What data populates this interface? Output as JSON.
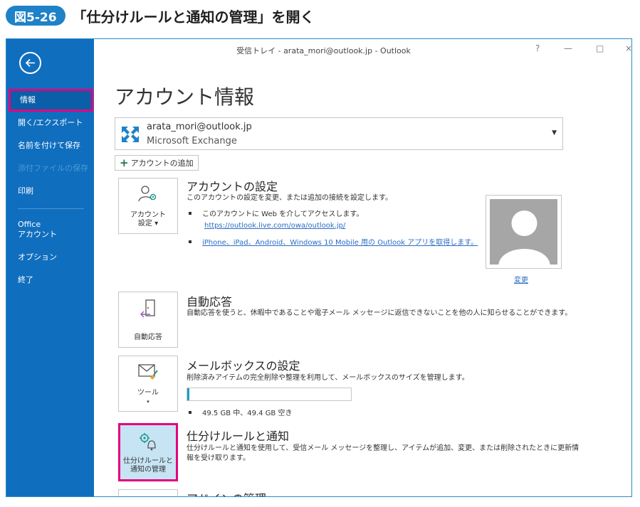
{
  "figure": {
    "badge": "図5-26",
    "title": "「仕分けルールと通知の管理」を開く"
  },
  "window": {
    "title": "受信トレイ - arata_mori@outlook.jp  -  Outlook",
    "help_label": "?",
    "minimize_label": "—",
    "restore_label": "□",
    "close_label": "×"
  },
  "sidebar": {
    "items": [
      {
        "label": "情報",
        "selected": true
      },
      {
        "label": "開く/エクスポート"
      },
      {
        "label": "名前を付けて保存"
      },
      {
        "label": "添付ファイルの保存",
        "disabled": true
      },
      {
        "label": "印刷"
      },
      {
        "label": "Office"
      },
      {
        "label": "アカウント"
      },
      {
        "label": "オプション"
      },
      {
        "label": "終了"
      }
    ]
  },
  "main": {
    "title": "アカウント情報",
    "account": {
      "email": "arata_mori@outlook.jp",
      "type": "Microsoft Exchange"
    },
    "add_account": "アカウントの追加",
    "account_settings": {
      "tile_line1": "アカウント",
      "tile_line2": "設定 ▾",
      "title": "アカウントの設定",
      "desc": "このアカウントの設定を変更、または追加の接続を設定します。",
      "bullet1": "このアカウントに Web を介してアクセスします。",
      "link1": "https://outlook.live.com/owa/outlook.jp/",
      "link2": "iPhone、iPad、Android、Windows 10 Mobile 用の Outlook アプリを取得します。",
      "change": "変更"
    },
    "auto_reply": {
      "tile": "自動応答",
      "title": "自動応答",
      "desc": "自動応答を使うと、休暇中であることや電子メール メッセージに返信できないことを他の人に知らせることができます。"
    },
    "mailbox": {
      "tile": "ツール",
      "tile_sub": "▾",
      "title": "メールボックスの設定",
      "desc": "削除済みアイテムの完全削除や整理を利用して、メールボックスのサイズを管理します。",
      "storage": "49.5 GB 中、49.4 GB 空き",
      "used_fraction": 0.002
    },
    "rules": {
      "tile_line1": "仕分けルールと",
      "tile_line2": "通知の管理",
      "title": "仕分けルールと通知",
      "desc_line1": "仕分けルールと通知を使用して、受信メール メッセージを整理し、アイテムが追加、変更、または削除されたときに更新情",
      "desc_line2": "報を受け取ります。"
    },
    "addins": {
      "title": "アドインの管理"
    }
  },
  "colors": {
    "sidebar": "#106ebe",
    "highlight": "#e4007f",
    "badge": "#1e82c8",
    "link": "#2b6cc4"
  }
}
